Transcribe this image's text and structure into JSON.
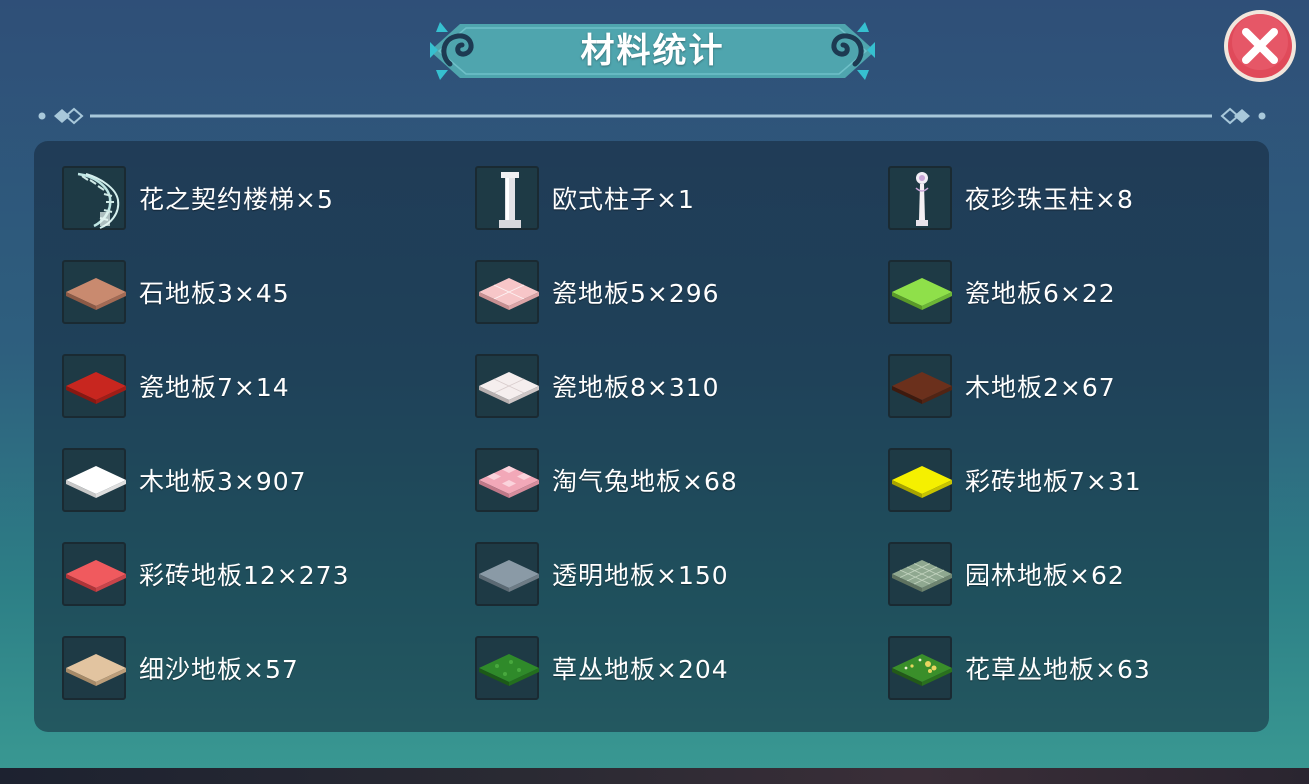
{
  "window": {
    "title": "材料统计"
  },
  "colors": {
    "banner": "#4fa5ae",
    "accent": "#36c0d0",
    "close_button": "#e04a5a"
  },
  "materials": [
    {
      "label": "花之契约楼梯×5",
      "icon": "spiral-staircase-icon",
      "color": "#9ecfcf"
    },
    {
      "label": "欧式柱子×1",
      "icon": "european-column-icon",
      "color": "#e8e8ea"
    },
    {
      "label": "夜珍珠玉柱×8",
      "icon": "pearl-jade-column-icon",
      "color": "#e8e0f0"
    },
    {
      "label": "石地板3×45",
      "icon": "stone-floor-tile-icon",
      "color": "#c98a6f"
    },
    {
      "label": "瓷地板5×296",
      "icon": "porcelain-floor-tile-icon",
      "color": "#f7c6c8"
    },
    {
      "label": "瓷地板6×22",
      "icon": "porcelain-floor-tile-icon",
      "color": "#8fe04a"
    },
    {
      "label": "瓷地板7×14",
      "icon": "porcelain-floor-tile-icon",
      "color": "#c8261f"
    },
    {
      "label": "瓷地板8×310",
      "icon": "porcelain-floor-tile-icon",
      "color": "#f5eeee"
    },
    {
      "label": "木地板2×67",
      "icon": "wood-floor-tile-icon",
      "color": "#6b301c"
    },
    {
      "label": "木地板3×907",
      "icon": "wood-floor-tile-icon",
      "color": "#ffffff"
    },
    {
      "label": "淘气兔地板×68",
      "icon": "bunny-floor-tile-icon",
      "color": "#f2a8b8"
    },
    {
      "label": "彩砖地板7×31",
      "icon": "colored-brick-floor-icon",
      "color": "#f5f000"
    },
    {
      "label": "彩砖地板12×273",
      "icon": "colored-brick-floor-icon",
      "color": "#f05a5e"
    },
    {
      "label": "透明地板×150",
      "icon": "transparent-floor-tile-icon",
      "color": "#8a9aa6"
    },
    {
      "label": "园林地板×62",
      "icon": "garden-floor-tile-icon",
      "color": "#8fa890"
    },
    {
      "label": "细沙地板×57",
      "icon": "sand-floor-tile-icon",
      "color": "#e2c4a0"
    },
    {
      "label": "草丛地板×204",
      "icon": "grass-floor-tile-icon",
      "color": "#2f8a2a"
    },
    {
      "label": "花草丛地板×63",
      "icon": "flower-grass-floor-tile-icon",
      "color": "#3a8f2a"
    }
  ]
}
